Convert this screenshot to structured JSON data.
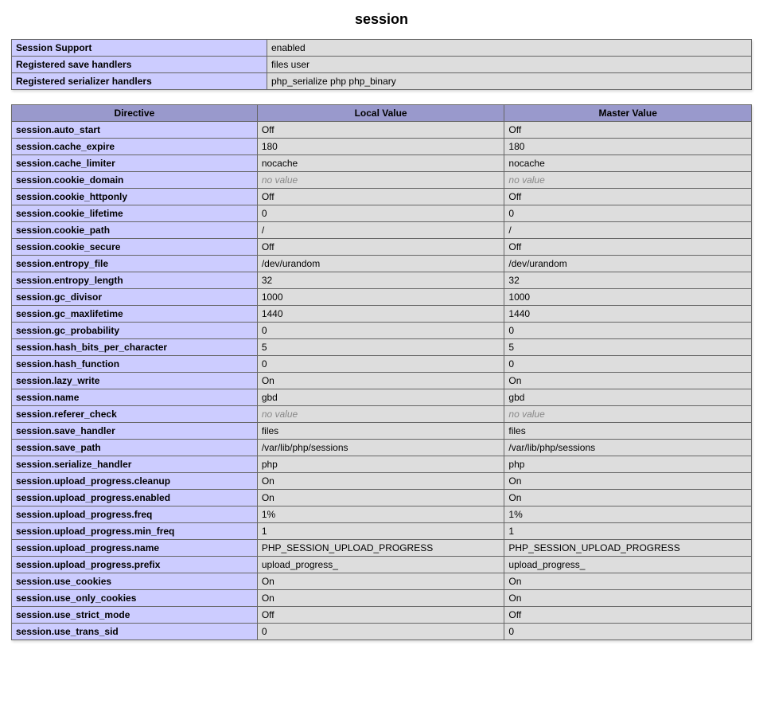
{
  "section_title": "session",
  "info_rows": [
    {
      "label": "Session Support",
      "value": "enabled"
    },
    {
      "label": "Registered save handlers",
      "value": "files user"
    },
    {
      "label": "Registered serializer handlers",
      "value": "php_serialize php php_binary"
    }
  ],
  "dir_headers": {
    "directive": "Directive",
    "local": "Local Value",
    "master": "Master Value"
  },
  "no_value_text": "no value",
  "directives": [
    {
      "name": "session.auto_start",
      "local": "Off",
      "master": "Off"
    },
    {
      "name": "session.cache_expire",
      "local": "180",
      "master": "180"
    },
    {
      "name": "session.cache_limiter",
      "local": "nocache",
      "master": "nocache"
    },
    {
      "name": "session.cookie_domain",
      "local": null,
      "master": null
    },
    {
      "name": "session.cookie_httponly",
      "local": "Off",
      "master": "Off"
    },
    {
      "name": "session.cookie_lifetime",
      "local": "0",
      "master": "0"
    },
    {
      "name": "session.cookie_path",
      "local": "/",
      "master": "/"
    },
    {
      "name": "session.cookie_secure",
      "local": "Off",
      "master": "Off"
    },
    {
      "name": "session.entropy_file",
      "local": "/dev/urandom",
      "master": "/dev/urandom"
    },
    {
      "name": "session.entropy_length",
      "local": "32",
      "master": "32"
    },
    {
      "name": "session.gc_divisor",
      "local": "1000",
      "master": "1000"
    },
    {
      "name": "session.gc_maxlifetime",
      "local": "1440",
      "master": "1440"
    },
    {
      "name": "session.gc_probability",
      "local": "0",
      "master": "0"
    },
    {
      "name": "session.hash_bits_per_character",
      "local": "5",
      "master": "5"
    },
    {
      "name": "session.hash_function",
      "local": "0",
      "master": "0"
    },
    {
      "name": "session.lazy_write",
      "local": "On",
      "master": "On"
    },
    {
      "name": "session.name",
      "local": "gbd",
      "master": "gbd"
    },
    {
      "name": "session.referer_check",
      "local": null,
      "master": null
    },
    {
      "name": "session.save_handler",
      "local": "files",
      "master": "files"
    },
    {
      "name": "session.save_path",
      "local": "/var/lib/php/sessions",
      "master": "/var/lib/php/sessions"
    },
    {
      "name": "session.serialize_handler",
      "local": "php",
      "master": "php"
    },
    {
      "name": "session.upload_progress.cleanup",
      "local": "On",
      "master": "On"
    },
    {
      "name": "session.upload_progress.enabled",
      "local": "On",
      "master": "On"
    },
    {
      "name": "session.upload_progress.freq",
      "local": "1%",
      "master": "1%"
    },
    {
      "name": "session.upload_progress.min_freq",
      "local": "1",
      "master": "1"
    },
    {
      "name": "session.upload_progress.name",
      "local": "PHP_SESSION_UPLOAD_PROGRESS",
      "master": "PHP_SESSION_UPLOAD_PROGRESS"
    },
    {
      "name": "session.upload_progress.prefix",
      "local": "upload_progress_",
      "master": "upload_progress_"
    },
    {
      "name": "session.use_cookies",
      "local": "On",
      "master": "On"
    },
    {
      "name": "session.use_only_cookies",
      "local": "On",
      "master": "On"
    },
    {
      "name": "session.use_strict_mode",
      "local": "Off",
      "master": "Off"
    },
    {
      "name": "session.use_trans_sid",
      "local": "0",
      "master": "0"
    }
  ]
}
